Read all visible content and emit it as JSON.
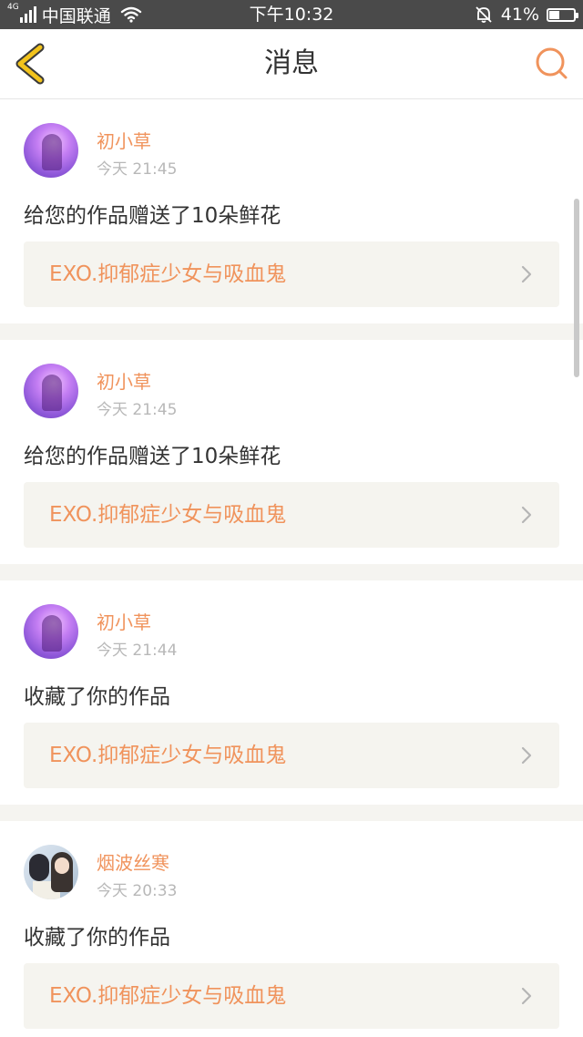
{
  "status_bar": {
    "network": "4G",
    "carrier": "中国联通",
    "time": "下午10:32",
    "battery": "41%",
    "battery_level": 0.41
  },
  "header": {
    "title": "消息",
    "back_icon": "back-chevron-icon",
    "search_icon": "search-icon"
  },
  "messages": [
    {
      "user": "初小草",
      "time": "今天 21:45",
      "text": "给您的作品赠送了10朵鲜花",
      "work": "EXO.抑郁症少女与吸血鬼",
      "avatar": "purple-avatar"
    },
    {
      "user": "初小草",
      "time": "今天 21:45",
      "text": "给您的作品赠送了10朵鲜花",
      "work": "EXO.抑郁症少女与吸血鬼",
      "avatar": "purple-avatar"
    },
    {
      "user": "初小草",
      "time": "今天 21:44",
      "text": "收藏了你的作品",
      "work": "EXO.抑郁症少女与吸血鬼",
      "avatar": "purple-avatar"
    },
    {
      "user": "烟波丝寒",
      "time": "今天 20:33",
      "text": "收藏了你的作品",
      "work": "EXO.抑郁症少女与吸血鬼",
      "avatar": "photo-avatar"
    }
  ],
  "colors": {
    "accent": "#f0935c",
    "back_icon": "#f2c31c",
    "status_bar": "#4a4a4a",
    "card_bg": "#f5f4ef"
  }
}
